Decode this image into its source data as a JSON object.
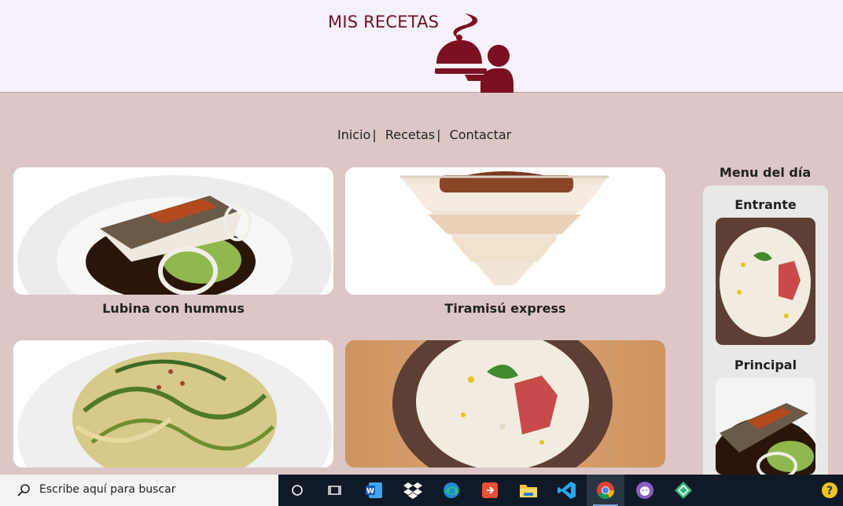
{
  "header": {
    "title": "MIS RECETAS",
    "logo_icon": "waiter-cloche-icon",
    "brand_color": "#7b1020"
  },
  "nav": {
    "items": [
      "Inicio",
      "Recetas",
      "Contactar"
    ],
    "separator": "|"
  },
  "recipes": [
    {
      "title": "Lubina con hummus",
      "image": "sea-bass-dish"
    },
    {
      "title": "Tiramisú express",
      "image": "tiramisu-glass"
    },
    {
      "title": "",
      "image": "zucchini-noodles"
    },
    {
      "title": "",
      "image": "white-soup-bowl"
    }
  ],
  "menu_del_dia": {
    "title": "Menu del día",
    "sections": [
      {
        "label": "Entrante",
        "image": "white-soup-bowl"
      },
      {
        "label": "Principal",
        "image": "sea-bass-dish"
      }
    ]
  },
  "taskbar": {
    "search_placeholder": "Escribe aquí para buscar",
    "apps": [
      "cortana-icon",
      "task-view-icon",
      "word-icon",
      "dropbox-icon",
      "edge-icon",
      "git-icon",
      "file-explorer-icon",
      "vscode-icon",
      "chrome-icon",
      "github-desktop-icon",
      "gitkraken-icon",
      "help-icon"
    ]
  }
}
